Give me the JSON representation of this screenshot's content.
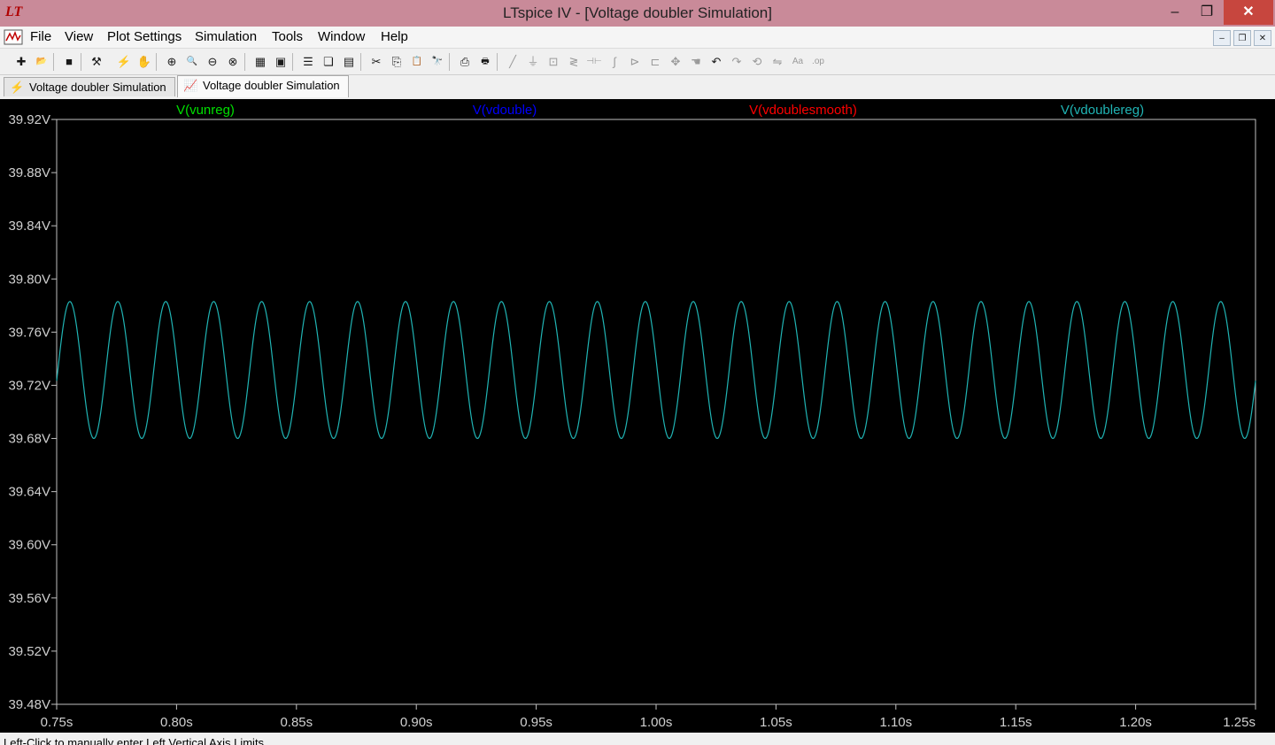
{
  "window": {
    "title": "LTspice IV - [Voltage doubler Simulation]",
    "minimize_glyph": "–",
    "maximize_glyph": "❐",
    "close_glyph": "✕"
  },
  "menu": {
    "items": [
      "File",
      "View",
      "Plot Settings",
      "Simulation",
      "Tools",
      "Window",
      "Help"
    ],
    "mdi_minimize": "–",
    "mdi_restore": "❐",
    "mdi_close": "✕"
  },
  "toolbar": {
    "buttons": [
      {
        "icon": "new-schematic-icon",
        "glyph": "✚",
        "dim": false
      },
      {
        "icon": "open-icon",
        "glyph": "📂",
        "dim": false
      },
      {
        "icon": "save-icon",
        "glyph": "■",
        "dim": false
      },
      {
        "icon": "control-panel-icon",
        "glyph": "⚒",
        "dim": false
      },
      {
        "icon": "run-icon",
        "glyph": "⚡",
        "dim": false
      },
      {
        "icon": "halt-icon",
        "glyph": "✋",
        "dim": true
      },
      {
        "icon": "zoom-area-icon",
        "glyph": "⊕",
        "dim": false
      },
      {
        "icon": "zoom-in-icon",
        "glyph": "🔍",
        "dim": false
      },
      {
        "icon": "zoom-out-icon",
        "glyph": "⊖",
        "dim": false
      },
      {
        "icon": "zoom-cancel-icon",
        "glyph": "⊗",
        "dim": false
      },
      {
        "icon": "autorange-icon",
        "glyph": "▦",
        "dim": false
      },
      {
        "icon": "autorange-y-icon",
        "glyph": "▣",
        "dim": false
      },
      {
        "icon": "tile-horizontal-icon",
        "glyph": "☰",
        "dim": false
      },
      {
        "icon": "cascade-icon",
        "glyph": "❏",
        "dim": false
      },
      {
        "icon": "tile-vertical-icon",
        "glyph": "▤",
        "dim": false
      },
      {
        "icon": "cut-icon",
        "glyph": "✂",
        "dim": false
      },
      {
        "icon": "copy-icon",
        "glyph": "⎘",
        "dim": false
      },
      {
        "icon": "paste-icon",
        "glyph": "📋",
        "dim": false
      },
      {
        "icon": "find-icon",
        "glyph": "🔭",
        "dim": false
      },
      {
        "icon": "print-setup-icon",
        "glyph": "⎙",
        "dim": false
      },
      {
        "icon": "print-icon",
        "glyph": "🖶",
        "dim": false
      },
      {
        "icon": "wire-icon",
        "glyph": "╱",
        "dim": true
      },
      {
        "icon": "ground-icon",
        "glyph": "⏚",
        "dim": true
      },
      {
        "icon": "label-net-icon",
        "glyph": "⊡",
        "dim": true
      },
      {
        "icon": "resistor-icon",
        "glyph": "≷",
        "dim": true
      },
      {
        "icon": "capacitor-icon",
        "glyph": "⊣⊢",
        "dim": true
      },
      {
        "icon": "inductor-icon",
        "glyph": "∫",
        "dim": true
      },
      {
        "icon": "diode-icon",
        "glyph": "⊳",
        "dim": true
      },
      {
        "icon": "component-icon",
        "glyph": "⊏",
        "dim": true
      },
      {
        "icon": "move-icon",
        "glyph": "✥",
        "dim": true
      },
      {
        "icon": "drag-icon",
        "glyph": "☚",
        "dim": true
      },
      {
        "icon": "undo-icon",
        "glyph": "↶",
        "dim": false
      },
      {
        "icon": "redo-icon",
        "glyph": "↷",
        "dim": true
      },
      {
        "icon": "rotate-icon",
        "glyph": "⟲",
        "dim": true
      },
      {
        "icon": "mirror-icon",
        "glyph": "⇋",
        "dim": true
      },
      {
        "icon": "text-icon",
        "glyph": "Aa",
        "dim": true
      },
      {
        "icon": "spice-directive-icon",
        "glyph": ".op",
        "dim": true
      }
    ]
  },
  "tabs": [
    {
      "label": "Voltage doubler Simulation",
      "icon": "schematic-icon",
      "glyph": "⚡",
      "active": false
    },
    {
      "label": "Voltage doubler Simulation",
      "icon": "waveform-icon",
      "glyph": "📈",
      "active": true
    }
  ],
  "status": {
    "text": "Left-Click to manually enter Left Vertical Axis Limits"
  },
  "chart_data": {
    "type": "line",
    "title": "",
    "xlabel": "",
    "ylabel": "",
    "xlim": [
      0.75,
      1.25
    ],
    "ylim": [
      39.48,
      39.92
    ],
    "x_ticks": [
      "0.75s",
      "0.80s",
      "0.85s",
      "0.90s",
      "0.95s",
      "1.00s",
      "1.05s",
      "1.10s",
      "1.15s",
      "1.20s",
      "1.25s"
    ],
    "x_tick_values": [
      0.75,
      0.8,
      0.85,
      0.9,
      0.95,
      1.0,
      1.05,
      1.1,
      1.15,
      1.2,
      1.25
    ],
    "y_ticks": [
      "39.92V",
      "39.88V",
      "39.84V",
      "39.80V",
      "39.76V",
      "39.72V",
      "39.68V",
      "39.64V",
      "39.60V",
      "39.56V",
      "39.52V",
      "39.48V"
    ],
    "y_tick_values": [
      39.92,
      39.88,
      39.84,
      39.8,
      39.76,
      39.72,
      39.68,
      39.64,
      39.6,
      39.56,
      39.52,
      39.48
    ],
    "grid": false,
    "legend_position": "top",
    "background": "#000000",
    "series": [
      {
        "name": "V(vunreg)",
        "color": "#00e000",
        "visible": false
      },
      {
        "name": "V(vdouble)",
        "color": "#0000ff",
        "visible": false
      },
      {
        "name": "V(vdoublesmooth)",
        "color": "#ff0000",
        "visible": false
      },
      {
        "name": "V(vdoublereg)",
        "color": "#20b4b4",
        "visible": true,
        "frequency_hz": 50,
        "min": 39.68,
        "max": 39.783,
        "peak_times_s": [
          0.7555,
          0.7755,
          0.7955,
          0.8155,
          0.8355,
          0.8555,
          0.8755,
          0.8955,
          0.9155,
          0.9355,
          0.9555,
          0.9755,
          0.9955,
          1.0155,
          1.0355,
          1.0555,
          1.0755,
          1.0955,
          1.1155,
          1.1355,
          1.1555,
          1.1755,
          1.1955,
          1.2155,
          1.2355
        ],
        "trough_times_s": [
          0.7655,
          0.7855,
          0.8055,
          0.8255,
          0.8455,
          0.8655,
          0.8855,
          0.9055,
          0.9255,
          0.9455,
          0.9655,
          0.9855,
          1.0055,
          1.0255,
          1.0455,
          1.0655,
          1.0855,
          1.1055,
          1.1255,
          1.1455,
          1.1655,
          1.1855,
          1.2055,
          1.2255,
          1.2455
        ],
        "start_value": 39.738,
        "end_value": 39.73
      }
    ]
  }
}
